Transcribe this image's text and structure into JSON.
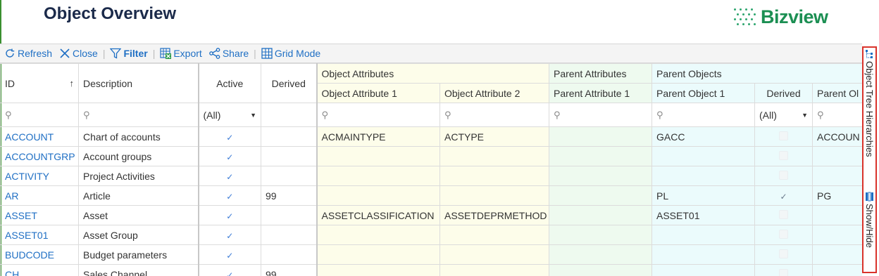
{
  "header": {
    "title": "Object Overview",
    "logo_text": "Bizview",
    "brand_color": "#1c8f53"
  },
  "toolbar": {
    "refresh": "Refresh",
    "close": "Close",
    "filter": "Filter",
    "export": "Export",
    "share": "Share",
    "grid_mode": "Grid Mode"
  },
  "columns": {
    "id": "ID",
    "description": "Description",
    "active": "Active",
    "derived": "Derived",
    "group_object_attributes": "Object Attributes",
    "group_parent_attributes": "Parent Attributes",
    "group_parent_objects": "Parent Objects",
    "object_attribute_1": "Object Attribute 1",
    "object_attribute_2": "Object Attribute 2",
    "parent_attribute_1": "Parent Attribute 1",
    "parent_object_1": "Parent Object 1",
    "parent_derived": "Derived",
    "parent_object_2": "Parent Ol"
  },
  "filters": {
    "active_select": "(All)",
    "parent_derived_select": "(All)"
  },
  "rows": [
    {
      "id": "ACCOUNT",
      "description": "Chart of accounts",
      "active": true,
      "derived": "",
      "oa1": "ACMAINTYPE",
      "oa2": "ACTYPE",
      "pa1": "",
      "po1": "GACC",
      "pderived": false,
      "po2": "ACCOUN"
    },
    {
      "id": "ACCOUNTGRP",
      "description": "Account groups",
      "active": true,
      "derived": "",
      "oa1": "",
      "oa2": "",
      "pa1": "",
      "po1": "",
      "pderived": false,
      "po2": ""
    },
    {
      "id": "ACTIVITY",
      "description": "Project Activities",
      "active": true,
      "derived": "",
      "oa1": "",
      "oa2": "",
      "pa1": "",
      "po1": "",
      "pderived": false,
      "po2": ""
    },
    {
      "id": "AR",
      "description": "Article",
      "active": true,
      "derived": "99",
      "oa1": "",
      "oa2": "",
      "pa1": "",
      "po1": "PL",
      "pderived": true,
      "po2": "PG"
    },
    {
      "id": "ASSET",
      "description": "Asset",
      "active": true,
      "derived": "",
      "oa1": "ASSETCLASSIFICATION",
      "oa2": "ASSETDEPRMETHOD",
      "pa1": "",
      "po1": "ASSET01",
      "pderived": false,
      "po2": ""
    },
    {
      "id": "ASSET01",
      "description": "Asset Group",
      "active": true,
      "derived": "",
      "oa1": "",
      "oa2": "",
      "pa1": "",
      "po1": "",
      "pderived": false,
      "po2": ""
    },
    {
      "id": "BUDCODE",
      "description": "Budget parameters",
      "active": true,
      "derived": "",
      "oa1": "",
      "oa2": "",
      "pa1": "",
      "po1": "",
      "pderived": false,
      "po2": ""
    },
    {
      "id": "CH",
      "description": "Sales Channel",
      "active": true,
      "derived": "99",
      "oa1": "",
      "oa2": "",
      "pa1": "",
      "po1": "",
      "pderived": false,
      "po2": ""
    }
  ],
  "side_panel": {
    "tree_label": "Object Tree Hierarchies",
    "showhide_label": "Show/Hide"
  }
}
